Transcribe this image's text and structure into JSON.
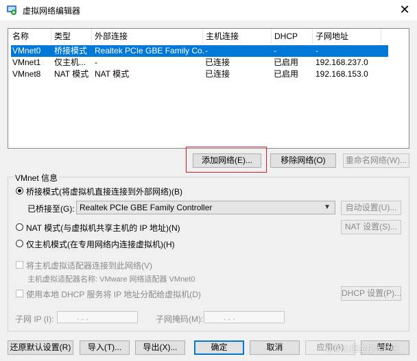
{
  "window": {
    "title": "虚拟网络编辑器",
    "close_glyph": "✕",
    "icon": "network-editor-icon"
  },
  "table": {
    "headers": [
      "名称",
      "类型",
      "外部连接",
      "主机连接",
      "DHCP",
      "子网地址"
    ],
    "rows": [
      [
        "VMnet0",
        "桥接模式",
        "Realtek PCIe GBE Family Co...",
        "-",
        "-",
        "-"
      ],
      [
        "VMnet1",
        "仅主机...",
        "-",
        "已连接",
        "已启用",
        "192.168.237.0"
      ],
      [
        "VMnet8",
        "NAT 模式",
        "NAT 模式",
        "已连接",
        "已启用",
        "192.168.153.0"
      ]
    ],
    "selected_row": 0
  },
  "network_buttons": {
    "add": "添加网络(E)...",
    "remove": "移除网络(O)",
    "rename": "重命名网络(W)..."
  },
  "vmnet_info": {
    "legend": "VMnet 信息",
    "bridged_label": "桥接模式(将虚拟机直接连接到外部网络)(B)",
    "bridged_to_label": "已桥接至(G):",
    "bridged_to_value": "Realtek PCIe GBE Family Controller",
    "auto_settings": "自动设置(U)...",
    "nat_label": "NAT 模式(与虚拟机共享主机的 IP 地址)(N)",
    "nat_settings": "NAT 设置(S)...",
    "hostonly_label": "仅主机模式(在专用网络内连接虚拟机)(H)",
    "selected_mode": "bridged",
    "connect_adapter_label": "将主机虚拟适配器连接到此网络(V)",
    "adapter_name_label": "主机虚拟适配器名称: VMware 网络适配器 VMnet0",
    "dhcp_label": "使用本地 DHCP 服务将 IP 地址分配给虚拟机(D)",
    "dhcp_settings": "DHCP 设置(P)...",
    "subnet_ip_label": "子网 IP (I):",
    "subnet_mask_label": "子网掩码(M):",
    "ip_dots": ". . ."
  },
  "footer_buttons": {
    "restore": "还原默认设置(R)",
    "import": "导入(T)...",
    "export": "导出(X)...",
    "ok": "确定",
    "cancel": "取消",
    "apply": "应用(A)",
    "help": "帮助"
  },
  "watermark": "@稀土掘金技术社区"
}
